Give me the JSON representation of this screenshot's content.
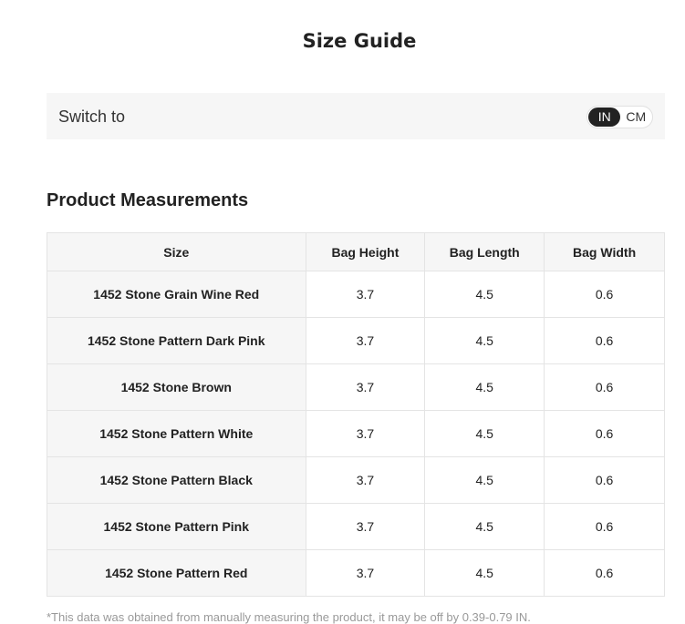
{
  "page_title": "Size Guide",
  "unit_switch": {
    "label": "Switch to",
    "options": [
      "IN",
      "CM"
    ],
    "selected": "IN"
  },
  "section_title": "Product Measurements",
  "table": {
    "headers": [
      "Size",
      "Bag Height",
      "Bag Length",
      "Bag Width"
    ],
    "rows": [
      [
        "1452 Stone Grain Wine Red",
        "3.7",
        "4.5",
        "0.6"
      ],
      [
        "1452 Stone Pattern Dark Pink",
        "3.7",
        "4.5",
        "0.6"
      ],
      [
        "1452 Stone Brown",
        "3.7",
        "4.5",
        "0.6"
      ],
      [
        "1452 Stone Pattern White",
        "3.7",
        "4.5",
        "0.6"
      ],
      [
        "1452 Stone Pattern Black",
        "3.7",
        "4.5",
        "0.6"
      ],
      [
        "1452 Stone Pattern Pink",
        "3.7",
        "4.5",
        "0.6"
      ],
      [
        "1452 Stone Pattern Red",
        "3.7",
        "4.5",
        "0.6"
      ]
    ]
  },
  "footnote": "*This data was obtained from manually measuring the product, it may be off by 0.39-0.79 IN.",
  "colors": {
    "toggle_active_bg": "#222222",
    "panel_bg": "#f6f6f6",
    "border": "#e4e4e4"
  }
}
